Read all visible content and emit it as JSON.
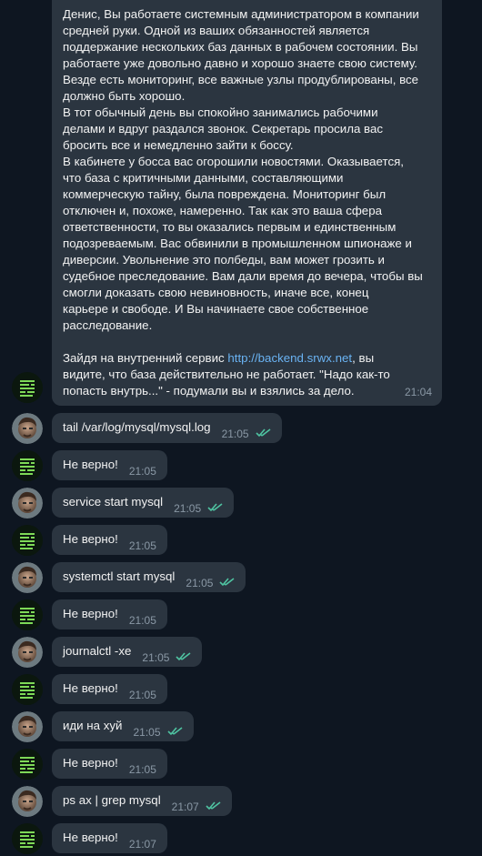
{
  "story": {
    "paragraphs": [
      "Денис, Вы работаете системным администратором в компании\nсредней руки. Одной из ваших обязанностей является\nподдержание нескольких баз данных в рабочем состоянии. Вы\nработаете уже довольно давно и хорошо знаете свою систему.\nВезде есть мониторинг, все важные узлы продублированы, все\nдолжно быть хорошо.",
      "В тот обычный день вы спокойно занимались рабочими\nделами и вдруг раздался звонок. Секретарь просила вас\nбросить все и немедленно зайти к боссу.",
      "В кабинете у босса вас огорошили новостями. Оказывается,\nчто база с критичными данными, составляющими\nкоммерческую тайну, была повреждена. Мониторинг был\nотключен и, похоже, намеренно. Так как это ваша сфера\nответственности, то вы оказались первым и единственным\nподозреваемым. Вас обвинили в промышленном шпионаже и\nдиверсии. Увольнение это полбеды, вам может грозить и\nсудебное преследование. Вам дали время до вечера, чтобы вы\nсмогли доказать свою невиновность, иначе все, конец\nкарьере и свободе. И Вы начинаете свое собственное\nрасследование."
    ],
    "final_before": "Зайдя на внутренний сервис ",
    "final_link": "http://backend.srwx.net",
    "final_after1": ", вы",
    "final_line2": "видите, что база действительно не работает. \"Надо как-то",
    "final_line3": "попасть внутрь...\" - подумали вы и взялись за дело.",
    "time": "21:04"
  },
  "messages": [
    {
      "sender": "user",
      "text": "tail /var/log/mysql/mysql.log",
      "time": "21:05"
    },
    {
      "sender": "bot",
      "text": "Не верно!",
      "time": "21:05"
    },
    {
      "sender": "user",
      "text": "service start mysql",
      "time": "21:05"
    },
    {
      "sender": "bot",
      "text": "Не верно!",
      "time": "21:05"
    },
    {
      "sender": "user",
      "text": "systemctl start mysql",
      "time": "21:05"
    },
    {
      "sender": "bot",
      "text": "Не верно!",
      "time": "21:05"
    },
    {
      "sender": "user",
      "text": "journalctl -xe",
      "time": "21:05"
    },
    {
      "sender": "bot",
      "text": "Не верно!",
      "time": "21:05"
    },
    {
      "sender": "user",
      "text": "иди на хуй",
      "time": "21:05"
    },
    {
      "sender": "bot",
      "text": "Не верно!",
      "time": "21:05"
    },
    {
      "sender": "user",
      "text": "ps ax | grep mysql",
      "time": "21:07"
    },
    {
      "sender": "bot",
      "text": "Не верно!",
      "time": "21:07"
    }
  ],
  "colors": {
    "background": "#0e1621",
    "bubble": "#2b3540",
    "link": "#6ab3f3",
    "read_ticks": "#4fc3a1",
    "bot_avatar": "#7ed957"
  },
  "icons": {
    "bot_avatar": "terminal-lines-icon",
    "user_avatar": "user-photo-avatar",
    "read_status": "double-check-icon"
  }
}
